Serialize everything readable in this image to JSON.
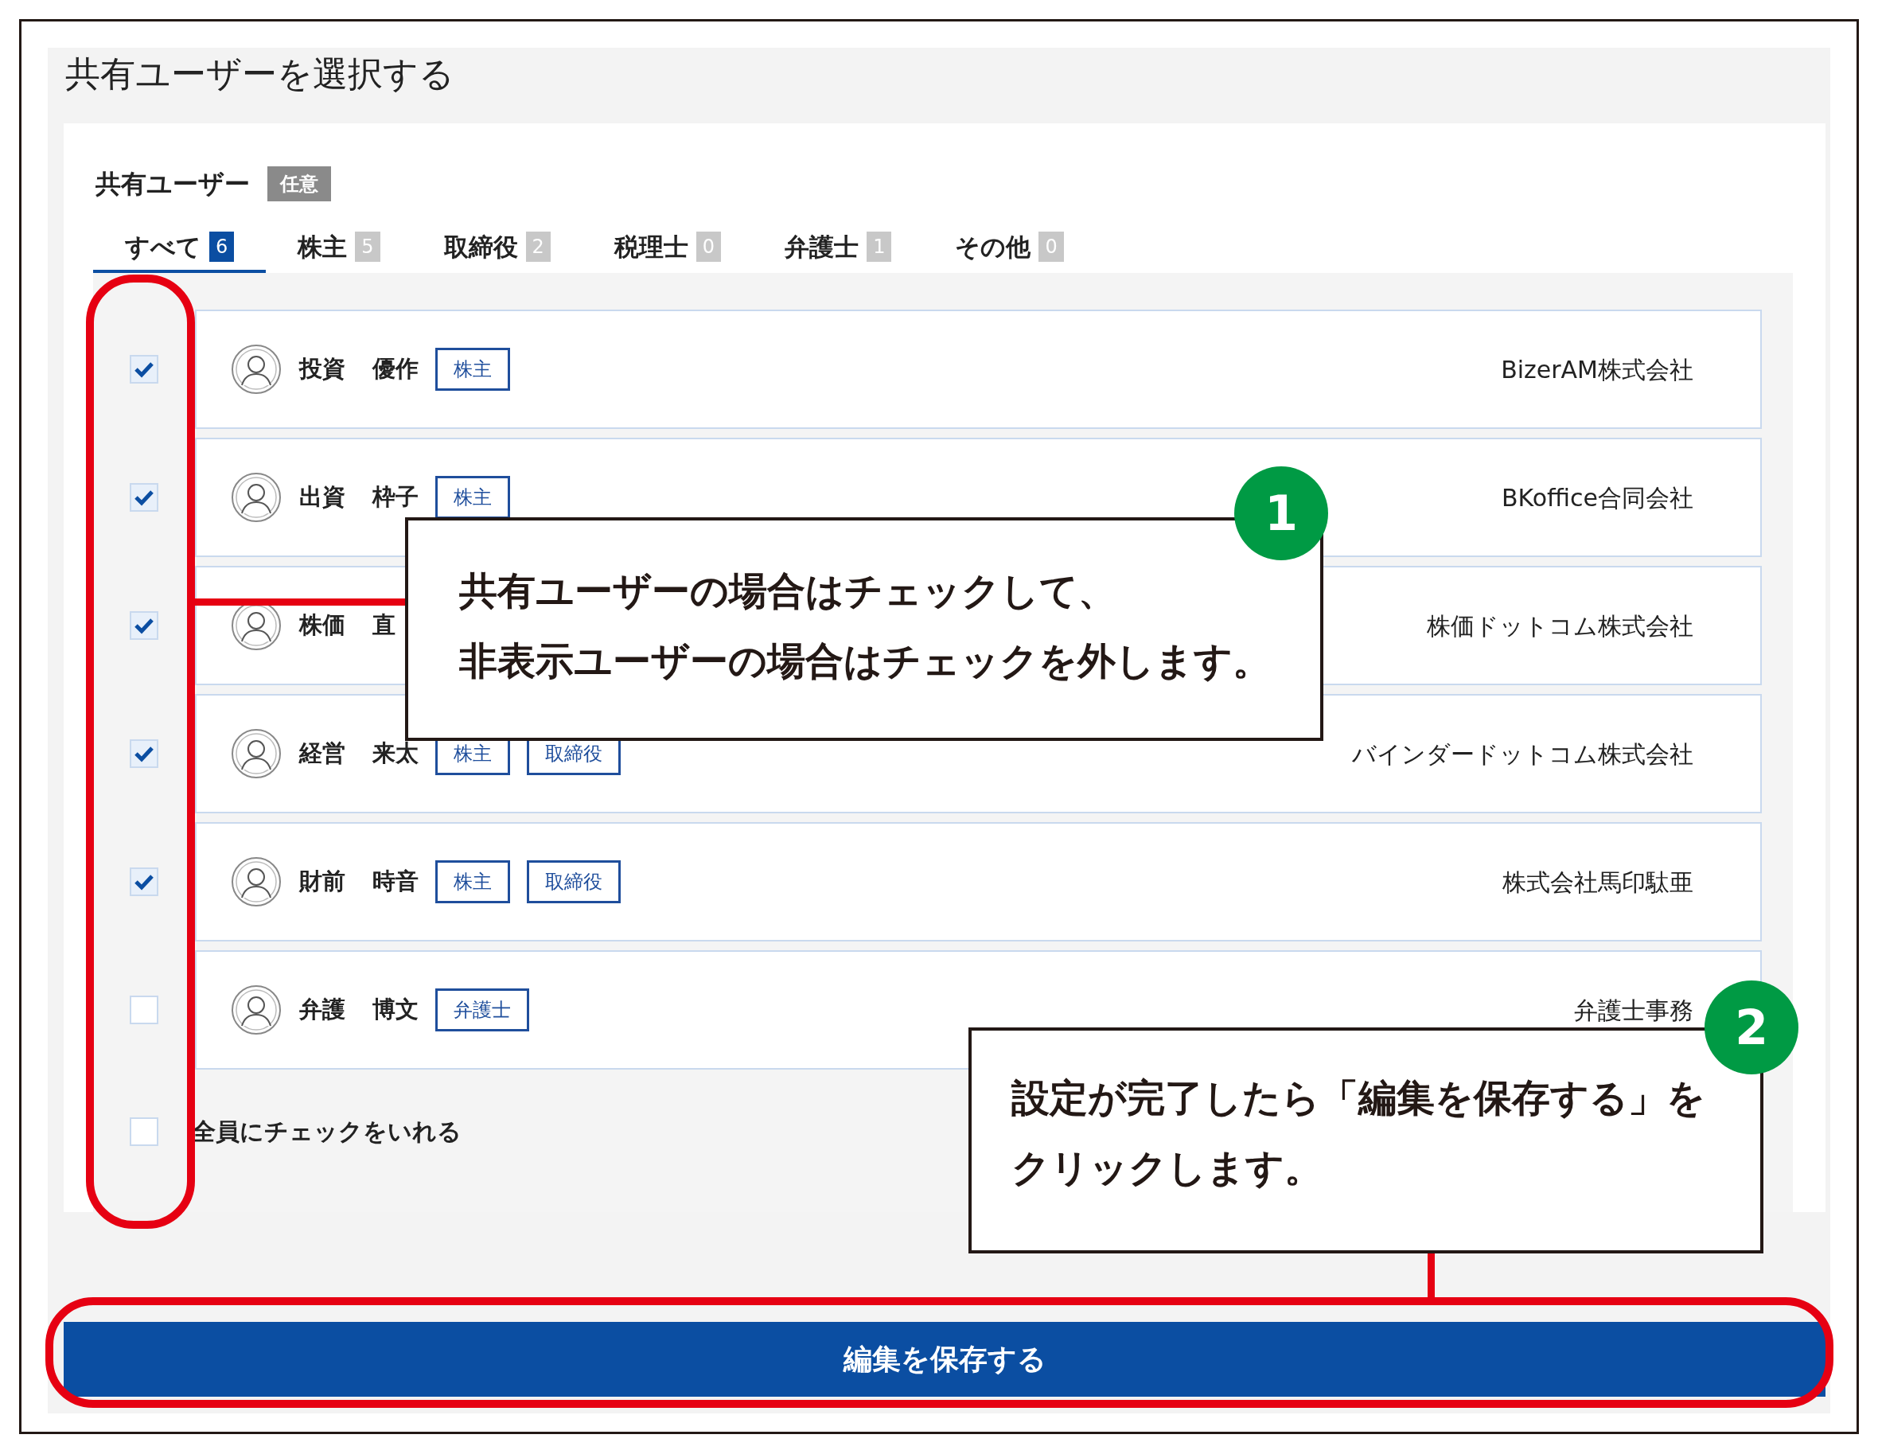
{
  "title": "共有ユーザーを選択する",
  "field": {
    "label": "共有ユーザー",
    "badge": "任意"
  },
  "tabs": [
    {
      "label": "すべて",
      "count": "6",
      "selected": true
    },
    {
      "label": "株主",
      "count": "5",
      "selected": false
    },
    {
      "label": "取締役",
      "count": "2",
      "selected": false
    },
    {
      "label": "税理士",
      "count": "0",
      "selected": false
    },
    {
      "label": "弁護士",
      "count": "1",
      "selected": false
    },
    {
      "label": "その他",
      "count": "0",
      "selected": false
    }
  ],
  "users": [
    {
      "checked": true,
      "last_name": "投資",
      "first_name": "優作",
      "tags": [
        "株主"
      ],
      "company": "BizerAM株式会社"
    },
    {
      "checked": true,
      "last_name": "出資",
      "first_name": "枠子",
      "tags": [
        "株主"
      ],
      "company": "BKoffice合同会社"
    },
    {
      "checked": true,
      "last_name": "株価",
      "first_name": "直",
      "company": "株価ドットコム株式会社"
    },
    {
      "checked": true,
      "last_name": "経営",
      "first_name": "来太",
      "tags": [
        "株主",
        "取締役"
      ],
      "company": "バインダードットコム株式会社"
    },
    {
      "checked": true,
      "last_name": "財前",
      "first_name": "時音",
      "tags": [
        "株主",
        "取締役"
      ],
      "company": "株式会社馬印駄亜"
    },
    {
      "checked": false,
      "last_name": "弁護",
      "first_name": "博文",
      "tags": [
        "弁護士"
      ],
      "company": "弁護士事務"
    }
  ],
  "select_all": {
    "label": "全員にチェックをいれる",
    "checked": false
  },
  "save_button": "編集を保存する",
  "callouts": [
    {
      "number": "1",
      "lines": [
        "共有ユーザーの場合はチェックして、",
        "非表示ユーザーの場合はチェックを外します。"
      ]
    },
    {
      "number": "2",
      "lines": [
        "設定が完了したら「編集を保存する」を",
        "クリックします。"
      ]
    }
  ]
}
